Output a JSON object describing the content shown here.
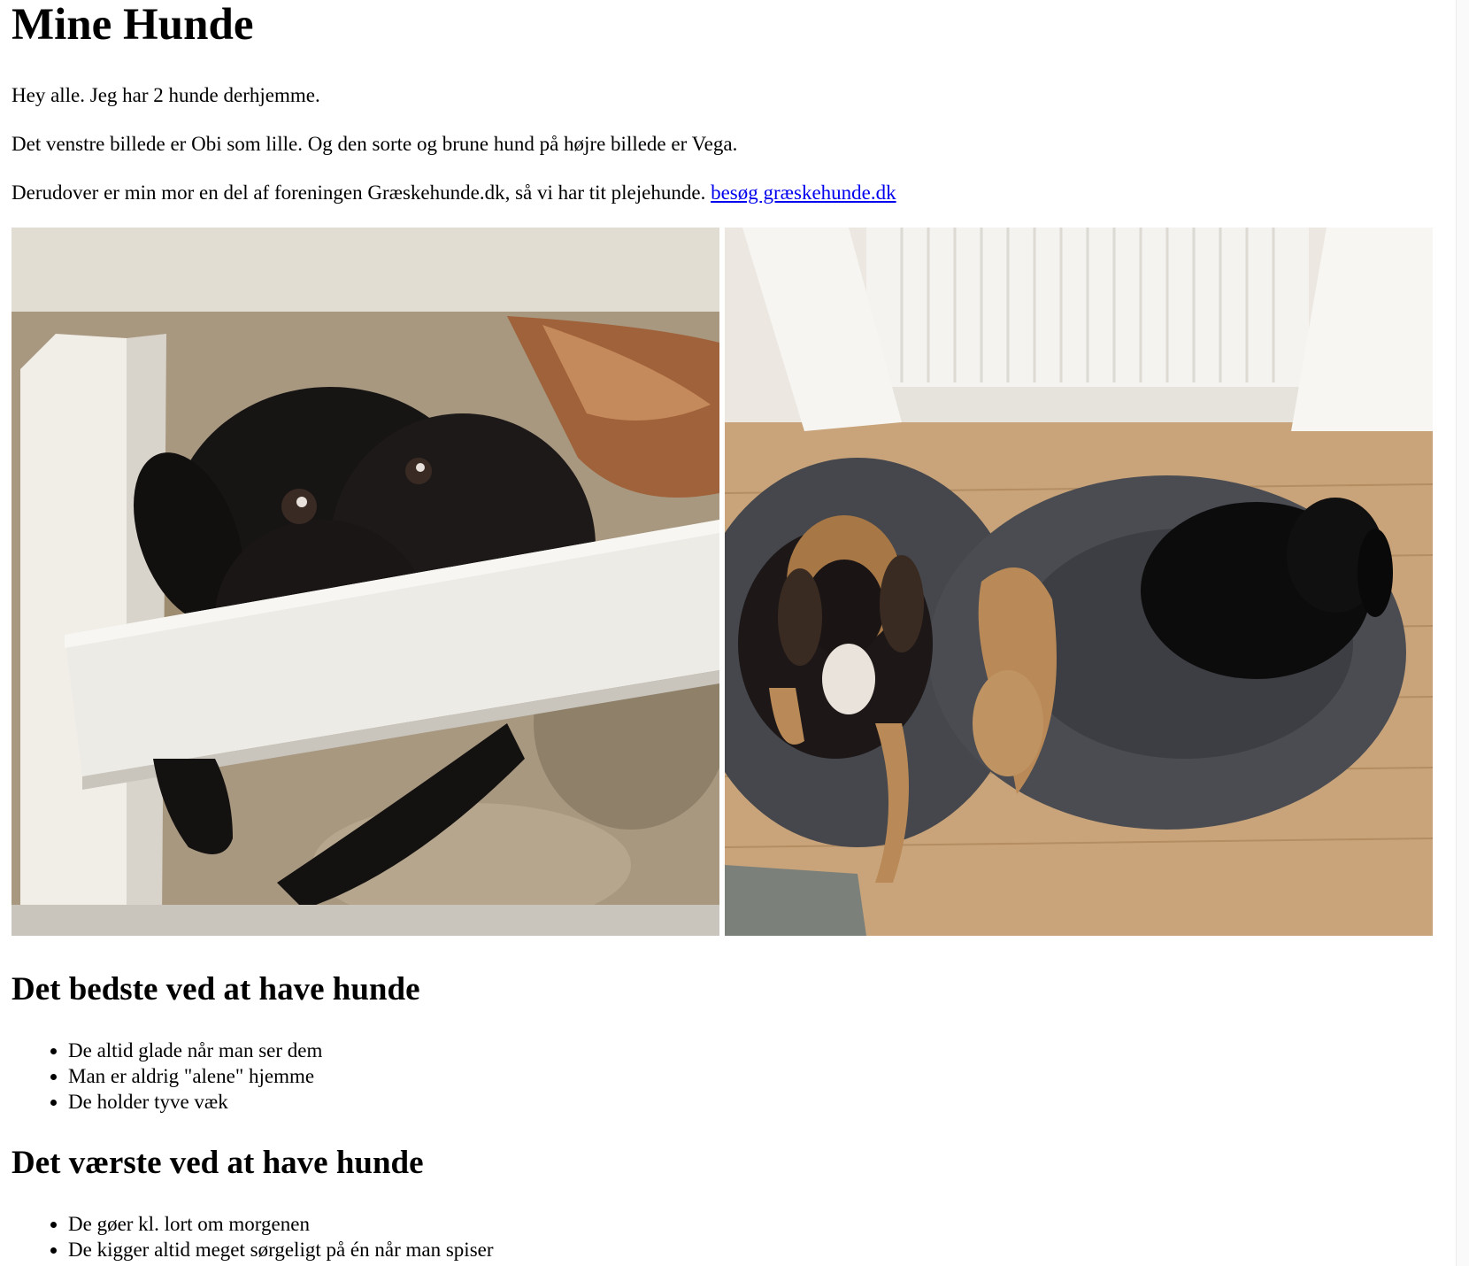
{
  "page": {
    "title": "Mine Hunde",
    "intro": "Hey alle. Jeg har 2 hunde derhjemme.",
    "photos_caption": "Det venstre billede er Obi som lille. Og den sorte og brune hund på højre billede er Vega.",
    "association_text": "Derudover er min mor en del af foreningen Græskehunde.dk, så vi har tit plejehunde. ",
    "association_link": "besøg græskehunde.dk"
  },
  "photos": {
    "left_icon": "puppy-photo",
    "right_icon": "dogs-in-beds-photo"
  },
  "best": {
    "heading": "Det bedste ved at have hunde",
    "items": [
      "De altid glade når man ser dem",
      "Man er aldrig \"alene\" hjemme",
      "De holder tyve væk"
    ]
  },
  "worst": {
    "heading": "Det værste ved at have hunde",
    "items": [
      "De gøer kl. lort om morgenen",
      "De kigger altid meget sørgeligt på én når man spiser"
    ]
  },
  "colors": {
    "link": "#0000ee",
    "text": "#000000",
    "background": "#ffffff"
  }
}
